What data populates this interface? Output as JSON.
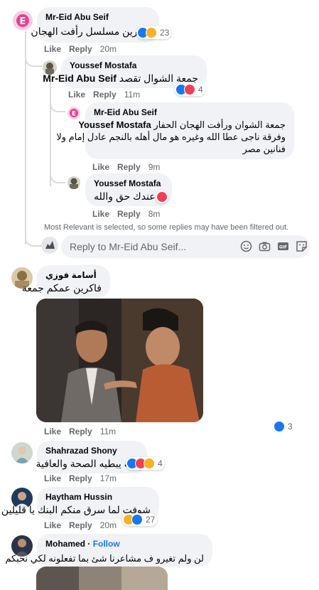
{
  "comments": {
    "c1": {
      "author": "Mr-Eid Abu Seif",
      "text": "فاكرين مسلسل رأفت الهجان",
      "reactions": "23",
      "like": "Like",
      "reply": "Reply",
      "time": "20m"
    },
    "r1": {
      "author": "Youssef Mostafa",
      "mention": "Mr-Eid Abu Seif",
      "text": "جمعة الشوال تقصد",
      "reactions": "4",
      "like": "Like",
      "reply": "Reply",
      "time": "11m"
    },
    "r2": {
      "author": "Mr-Eid Abu Seif",
      "mention": "Youssef Mostafa",
      "text": "جمعة الشوان ورأفت الهجان الحفار",
      "text2": "وفرقة ناجى عطا الله وغيره هو مال أهله بالنجم عادل إمام ولا",
      "text3": "فنانين مصر",
      "like": "Like",
      "reply": "Reply",
      "time": "9m"
    },
    "r3": {
      "author": "Youssef Mostafa",
      "text": "عندك حق والله",
      "like": "Like",
      "reply": "Reply",
      "time": "8m"
    },
    "c2": {
      "author": "أسامة فوزي",
      "text": "فاكرين عمكم جمعة",
      "reactions": "3",
      "like": "Like",
      "reply": "Reply",
      "time": "11m"
    },
    "c3": {
      "author": "Shahrazad Shony",
      "text": "الله يبطيه الصحة والعافية",
      "reactions": "4",
      "like": "Like",
      "reply": "Reply",
      "time": "17m"
    },
    "c4": {
      "author": "Haytham Hussin",
      "text": "شوفت لما سرق منكم البنك يا قليلين",
      "reactions": "27",
      "like": "Like",
      "reply": "Reply",
      "time": "20m"
    },
    "c5": {
      "author": "Mohamed",
      "follow": "Follow",
      "separator": " · ",
      "text": "لن ولم تغيرو ف مشاعرنا شئ بما تفعلونه لكي نحبكم"
    }
  },
  "notice": "Most Relevant is selected, so some replies may have been filtered out.",
  "reply_box": {
    "placeholder": "Reply to Mr-Eid Abu Seif..."
  },
  "icons": {
    "emoji": "emoji-icon",
    "camera": "camera-icon",
    "gif": "gif-icon",
    "sticker": "sticker-icon"
  },
  "colors": {
    "like": "#1877f2",
    "love": "#f33e58",
    "haha": "#f7b125",
    "secondary_text": "#65676b",
    "bubble": "#f0f2f5"
  }
}
